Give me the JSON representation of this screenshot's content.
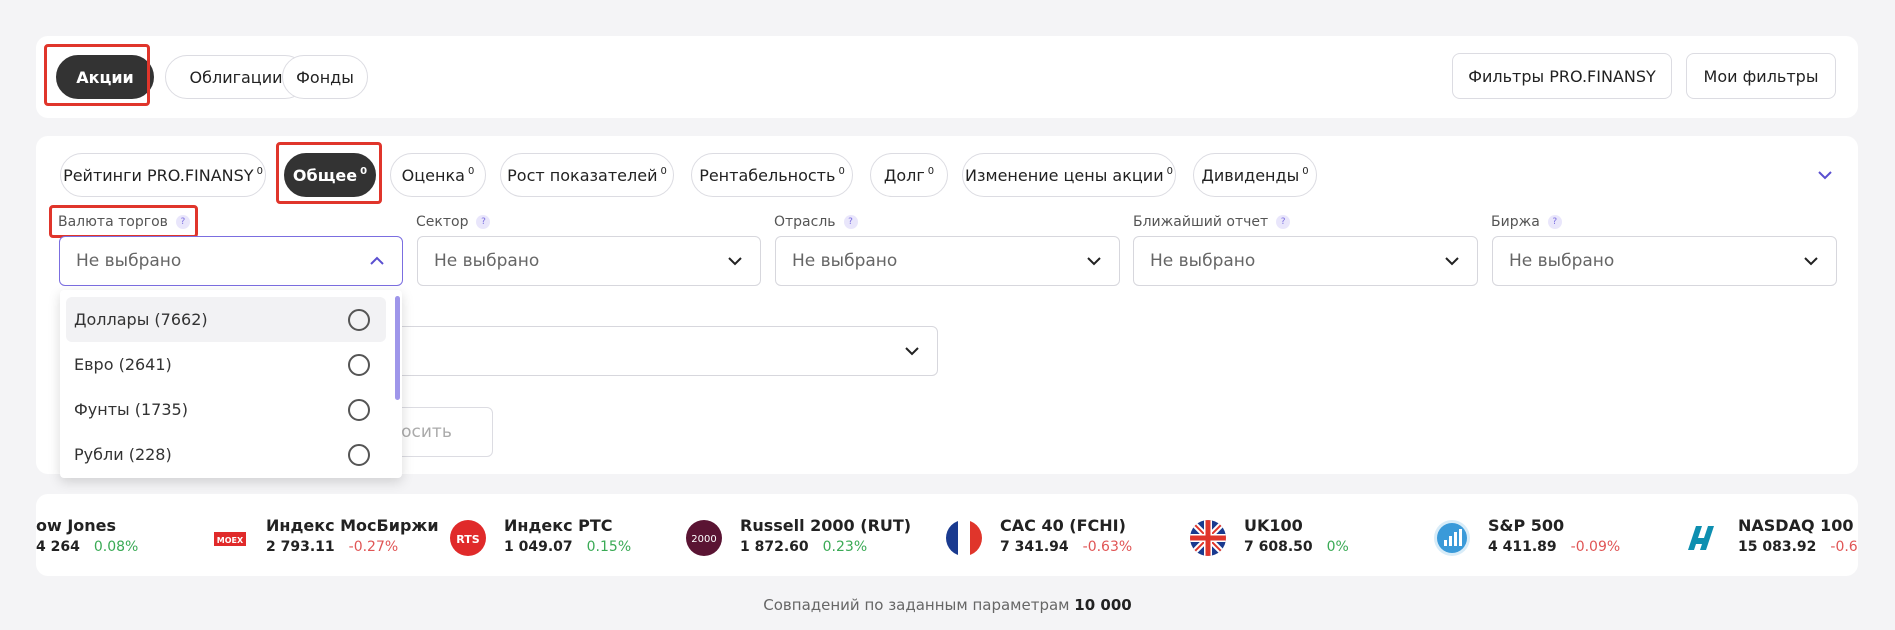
{
  "top": {
    "tabs": [
      "Акции",
      "Облигации",
      "Фонды"
    ],
    "buttons": [
      "Фильтры PRO.FINANSY",
      "Мои фильтры"
    ]
  },
  "categories": [
    {
      "label": "Рейтинги PRO.FINANSY",
      "count": "0"
    },
    {
      "label": "Общее",
      "count": "0"
    },
    {
      "label": "Оценка",
      "count": "0"
    },
    {
      "label": "Рост показателей",
      "count": "0"
    },
    {
      "label": "Рентабельность",
      "count": "0"
    },
    {
      "label": "Долг",
      "count": "0"
    },
    {
      "label": "Изменение цены акции",
      "count": "0"
    },
    {
      "label": "Дивиденды",
      "count": "0"
    }
  ],
  "filters": [
    {
      "label": "Валюта торгов",
      "value": "Не выбрано"
    },
    {
      "label": "Сектор",
      "value": "Не выбрано"
    },
    {
      "label": "Отрасль",
      "value": "Не выбрано"
    },
    {
      "label": "Ближайший отчет",
      "value": "Не выбрано"
    },
    {
      "label": "Биржа",
      "value": "Не выбрано"
    }
  ],
  "help_mark": "?",
  "dropdown": {
    "options": [
      "Доллары (7662)",
      "Евро (2641)",
      "Фунты (1735)",
      "Рубли (228)"
    ]
  },
  "reset_button": "осить",
  "ticker": [
    {
      "name": "ow Jones",
      "value": "4 264",
      "change": "0.08%",
      "dir": "pos"
    },
    {
      "name": "Индекс МосБиржи",
      "value": "2 793.11",
      "change": "-0.27%",
      "dir": "neg",
      "logo_text": "MOEX"
    },
    {
      "name": "Индекс РТС",
      "value": "1 049.07",
      "change": "0.15%",
      "dir": "pos",
      "logo_text": "RTS"
    },
    {
      "name": "Russell 2000 (RUT)",
      "value": "1 872.60",
      "change": "0.23%",
      "dir": "pos",
      "logo_text": "2000"
    },
    {
      "name": "CAC 40 (FCHI)",
      "value": "7 341.94",
      "change": "-0.63%",
      "dir": "neg"
    },
    {
      "name": "UK100",
      "value": "7 608.50",
      "change": "0%",
      "dir": "zero"
    },
    {
      "name": "S&P 500",
      "value": "4 411.89",
      "change": "-0.09%",
      "dir": "neg"
    },
    {
      "name": "NASDAQ 100",
      "value": "15 083.92",
      "change": "-0.6",
      "dir": "neg"
    }
  ],
  "footer": {
    "text": "Совпадений по заданным параметрам",
    "count": "10 000"
  },
  "colors": {
    "accent": "#7b6ee0",
    "highlight": "#e0352b",
    "dark_pill": "#333333",
    "positive": "#3aaa55",
    "negative": "#e05555"
  }
}
